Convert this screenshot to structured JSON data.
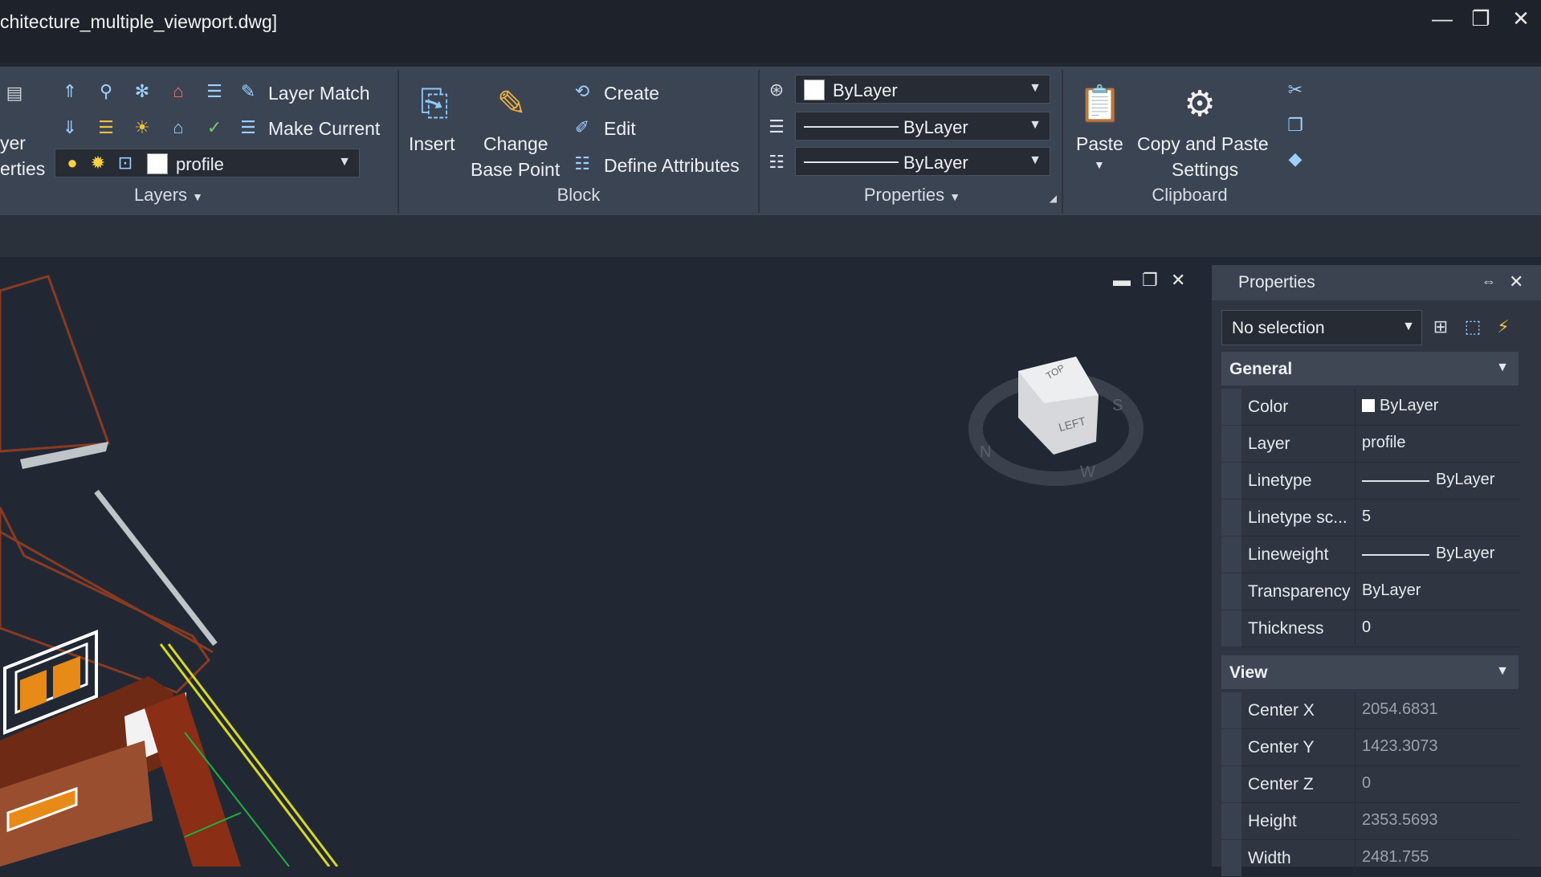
{
  "window": {
    "title": "chitecture_multiple_viewport.dwg]",
    "minimize": "—",
    "maximize": "❐",
    "close": "✕"
  },
  "ribbon": {
    "layers": {
      "partial_label_1": "yer",
      "partial_label_2": "erties",
      "layer_match": "Layer Match",
      "make_current": "Make Current",
      "current_layer": "profile",
      "title": "Layers"
    },
    "block": {
      "insert": "Insert",
      "change_base_point_1": "Change",
      "change_base_point_2": "Base Point",
      "create": "Create",
      "edit": "Edit",
      "define_attributes": "Define Attributes",
      "title": "Block"
    },
    "properties": {
      "color": "ByLayer",
      "lineweight": "ByLayer",
      "linetype": "ByLayer",
      "title": "Properties"
    },
    "clipboard": {
      "paste": "Paste",
      "copy_paste_1": "Copy and Paste",
      "copy_paste_2": "Settings",
      "title": "Clipboard"
    }
  },
  "viewcube": {
    "top": "TOP",
    "left": "LEFT",
    "s": "S",
    "n": "N",
    "w": "W"
  },
  "properties_palette": {
    "title": "Properties",
    "selection": "No selection",
    "general": {
      "title": "General",
      "rows": [
        {
          "label": "Color",
          "value": "ByLayer"
        },
        {
          "label": "Layer",
          "value": "profile"
        },
        {
          "label": "Linetype",
          "value": "ByLayer"
        },
        {
          "label": "Linetype sc...",
          "value": "5"
        },
        {
          "label": "Lineweight",
          "value": "ByLayer"
        },
        {
          "label": "Transparency",
          "value": "ByLayer"
        },
        {
          "label": "Thickness",
          "value": "0"
        }
      ]
    },
    "view": {
      "title": "View",
      "rows": [
        {
          "label": "Center X",
          "value": "2054.6831"
        },
        {
          "label": "Center Y",
          "value": "1423.3073"
        },
        {
          "label": "Center Z",
          "value": "0"
        },
        {
          "label": "Height",
          "value": "2353.5693"
        },
        {
          "label": "Width",
          "value": "2481.755"
        }
      ]
    }
  },
  "colors": {
    "ribbon_bg": "#3b4453",
    "canvas_bg": "#212834",
    "accent_blue": "#6fb6ff",
    "accent_orange": "#f0a030",
    "drawing_brown": "#8a3a20",
    "drawing_yellow": "#d8d820"
  }
}
